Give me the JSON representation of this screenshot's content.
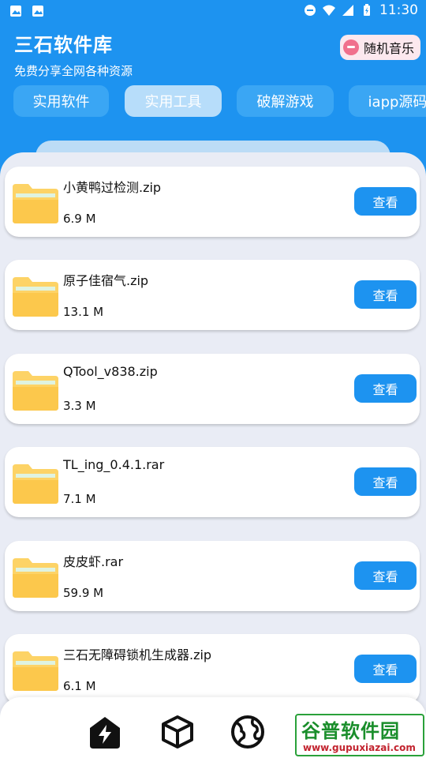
{
  "status_bar": {
    "time": "11:30"
  },
  "header": {
    "title": "三石软件库",
    "subtitle": "免费分享全网各种资源",
    "music_button": "随机音乐"
  },
  "tabs": [
    "实用软件",
    "实用工具",
    "破解游戏",
    "iapp源码"
  ],
  "active_tab": "实用工具",
  "files": [
    {
      "name": "小黄鸭过检测.zip",
      "size": "6.9 M",
      "action": "查看"
    },
    {
      "name": "原子佳宿气.zip",
      "size": "13.1 M",
      "action": "查看"
    },
    {
      "name": "QTool_v838.zip",
      "size": "3.3 M",
      "action": "查看"
    },
    {
      "name": "TL_ing_0.4.1.rar",
      "size": "7.1 M",
      "action": "查看"
    },
    {
      "name": "皮皮虾.rar",
      "size": "59.9 M",
      "action": "查看"
    },
    {
      "name": "三石无障碍锁机生成器.zip",
      "size": "6.1 M",
      "action": "查看"
    }
  ],
  "bottom_nav": [
    "flash-icon",
    "cube-icon",
    "globe-icon"
  ],
  "watermark": {
    "title": "谷普软件园",
    "url": "www.gupuxiazai.com"
  },
  "colors": {
    "primary": "#1d93f0",
    "folder": "#fdd366",
    "background": "#e9ecf5"
  }
}
